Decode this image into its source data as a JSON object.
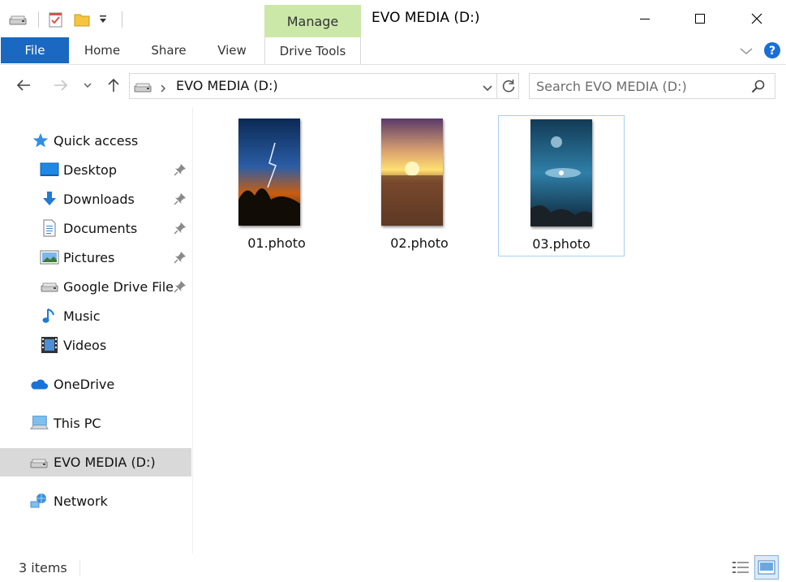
{
  "window": {
    "title": "EVO MEDIA (D:)",
    "contextual_tab": "Manage"
  },
  "ribbon": {
    "tabs": [
      "File",
      "Home",
      "Share",
      "View",
      "Drive Tools"
    ]
  },
  "address": {
    "breadcrumb": "EVO MEDIA (D:)",
    "search_placeholder": "Search EVO MEDIA (D:)"
  },
  "nav": {
    "quick_access": "Quick access",
    "items": [
      {
        "label": "Desktop",
        "icon": "desktop-icon",
        "pinned": true
      },
      {
        "label": "Downloads",
        "icon": "downloads-icon",
        "pinned": true
      },
      {
        "label": "Documents",
        "icon": "documents-icon",
        "pinned": true
      },
      {
        "label": "Pictures",
        "icon": "pictures-icon",
        "pinned": true
      },
      {
        "label": "Google Drive File",
        "icon": "drive-icon",
        "pinned": true
      },
      {
        "label": "Music",
        "icon": "music-icon",
        "pinned": false
      },
      {
        "label": "Videos",
        "icon": "videos-icon",
        "pinned": false
      }
    ],
    "onedrive": "OneDrive",
    "this_pc": "This PC",
    "evo": "EVO MEDIA (D:)",
    "network": "Network"
  },
  "files": [
    {
      "name": "01.photo",
      "selected": false
    },
    {
      "name": "02.photo",
      "selected": false
    },
    {
      "name": "03.photo",
      "selected": true
    }
  ],
  "status": {
    "count": "3 items"
  },
  "colors": {
    "file_tab": "#1a68c1",
    "manage_tab": "#cbe8a8",
    "selected_nav": "#d9d9d9",
    "selection_border": "#a8cfee"
  }
}
